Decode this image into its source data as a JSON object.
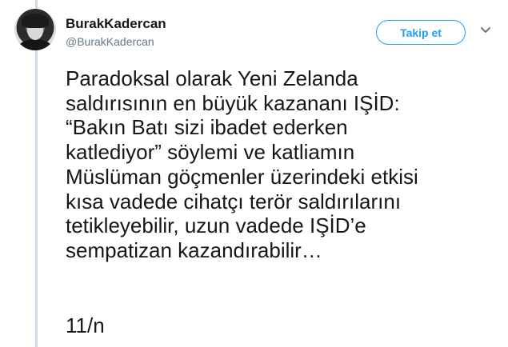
{
  "tweet": {
    "author": {
      "name": "BurakKadercan",
      "handle": "@BurakKadercan",
      "avatar_icon": "profile-photo"
    },
    "follow_label": "Takip et",
    "menu_icon": "chevron-down-icon",
    "text": "Paradoksal olarak Yeni Zelanda\nsaldırısının en büyük kazananı IŞİD:\n“Bakın Batı sizi ibadet ederken\nkatlediyor” söylemi ve katliamın\nMüslüman göçmenler üzerindeki etkisi\nkısa vadede cihatçı terör saldırılarını\ntetikleyebilir, uzun vadede IŞİD’e\nsempatizan kazandırabilir…",
    "counter": "11/n"
  },
  "colors": {
    "accent": "#1da1f2",
    "text_primary": "#14171a",
    "text_secondary": "#657786",
    "thread_line": "#cfd9e2"
  }
}
